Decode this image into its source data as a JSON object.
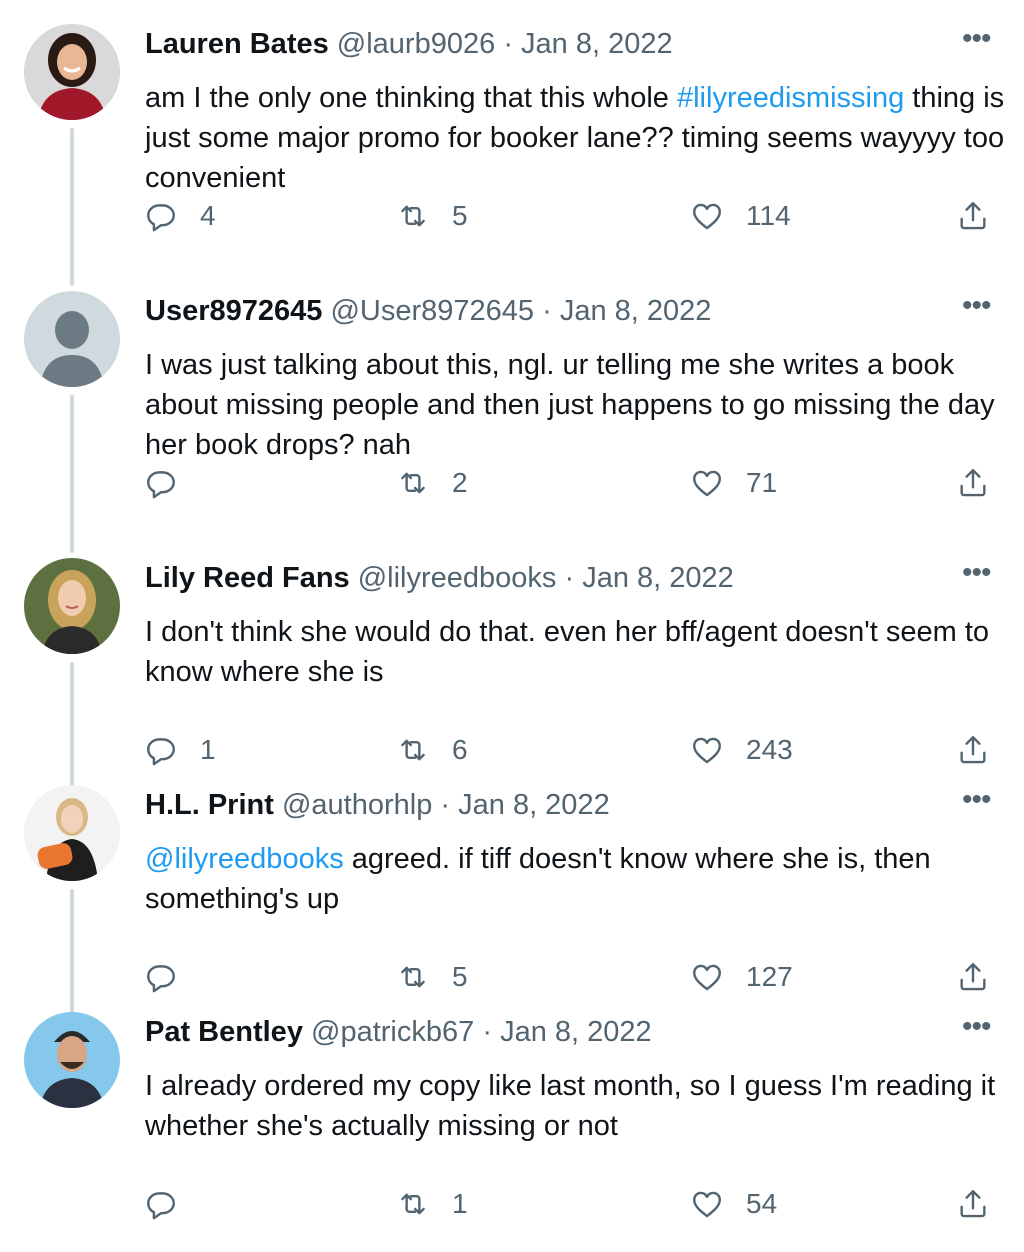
{
  "tweets": [
    {
      "name": "Lauren Bates",
      "handle": "@laurb9026",
      "date": "Jan 8, 2022",
      "text_parts": [
        "am I the only one thinking that this whole ",
        "#lilyreedismissing",
        " thing is just some major promo for booker lane?? timing seems wayyyy too convenient"
      ],
      "replies": "4",
      "retweets": "5",
      "likes": "114",
      "avatar_icon": "woman-red-sweater-avatar",
      "avatar_bg": "#e6e6e6"
    },
    {
      "name": "User8972645",
      "handle": "@User8972645",
      "date": "Jan 8, 2022",
      "text_parts": [
        "",
        "",
        "I was just talking about this, ngl. ur telling me she writes a book about missing people and then just happens to go missing the day her book drops? nah"
      ],
      "replies": "",
      "retweets": "2",
      "likes": "71",
      "avatar_icon": "default-user-avatar",
      "avatar_bg": "#cfd9de"
    },
    {
      "name": "Lily Reed Fans",
      "handle": "@lilyreedbooks",
      "date": "Jan 8, 2022",
      "text_parts": [
        "",
        "",
        "I don't think she would do that. even her bff/agent doesn't seem to know where she is"
      ],
      "replies": "1",
      "retweets": "6",
      "likes": "243",
      "avatar_icon": "blonde-woman-avatar",
      "avatar_bg": "#6b7d4a"
    },
    {
      "name": "H.L. Print",
      "handle": "@authorhlp",
      "date": "Jan 8, 2022",
      "text_parts": [
        "",
        "@lilyreedbooks",
        " agreed. if tiff doesn't know where she is, then something's up"
      ],
      "replies": "",
      "retweets": "5",
      "likes": "127",
      "avatar_icon": "woman-holding-pillow-avatar",
      "avatar_bg": "#f2f2f2"
    },
    {
      "name": "Pat Bentley",
      "handle": "@patrickb67",
      "date": "Jan 8, 2022",
      "text_parts": [
        "",
        "",
        "I already ordered my copy like last month, so I guess I'm reading it whether she's actually missing or not"
      ],
      "replies": "",
      "retweets": "1",
      "likes": "54",
      "avatar_icon": "man-beanie-avatar",
      "avatar_bg": "#7fc4e8"
    }
  ],
  "ui": {
    "more_glyph": "•••",
    "separator": "·"
  }
}
